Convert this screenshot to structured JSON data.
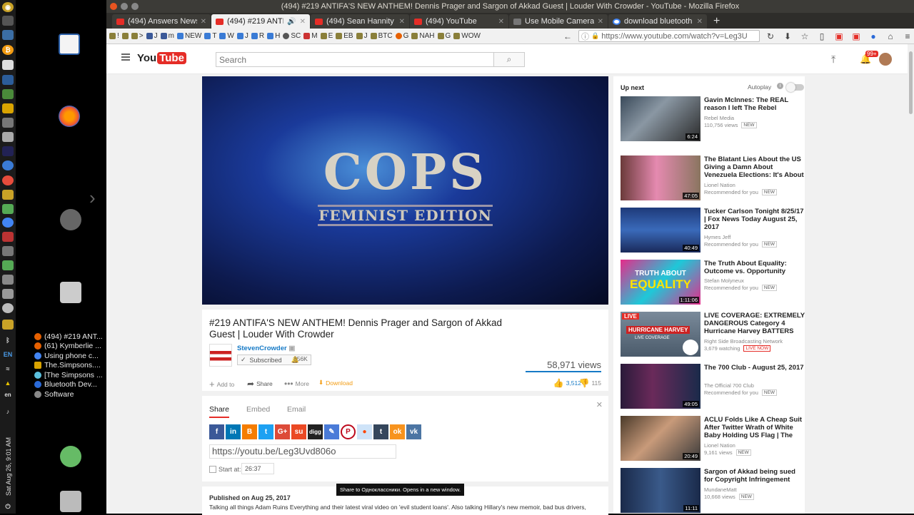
{
  "window": {
    "title": "(494) #219 ANTIFA'S NEW ANTHEM! Dennis Prager and Sargon of Akkad Guest | Louder With Crowder - YouTube - Mozilla Firefox"
  },
  "desktop_sidebar": {
    "clock": "Sat Aug 26, 9:01 AM",
    "lang": "en",
    "lang_en": "EN",
    "taskbar": [
      "(494) #219 ANT...",
      "(61) Kymberlie ...",
      "Using phone c...",
      "The.Simpsons....",
      "[The Simpsons ...",
      "Bluetooth Dev...",
      "Software"
    ]
  },
  "tabs": [
    {
      "label": "(494) Answers News –",
      "active": false
    },
    {
      "label": "(494) #219 ANTIFA'S",
      "active": true
    },
    {
      "label": "(494) Sean Hannity 8/2",
      "active": false
    },
    {
      "label": "(494) YouTube",
      "active": false
    },
    {
      "label": "Use Mobile Camera As",
      "active": false
    },
    {
      "label": "download bluetooth d",
      "active": false
    }
  ],
  "bookmarks": [
    "!",
    ">",
    "J",
    "m",
    "NEW",
    "T",
    "W",
    "J",
    "R",
    "H",
    "SC",
    "M",
    "E",
    "EB",
    "J",
    "BTC",
    "G",
    "NAH",
    "G",
    "WOW"
  ],
  "url": "https://www.youtube.com/watch?v=Leg3U",
  "youtube": {
    "logo_you": "You",
    "logo_tube": "Tube",
    "search_placeholder": "Search",
    "notif_count": "99+"
  },
  "player": {
    "title": "COPS",
    "subtitle": "FEMINIST EDITION"
  },
  "video": {
    "title": "#219 ANTIFA'S NEW ANTHEM! Dennis Prager and Sargon of Akkad Guest | Louder With Crowder",
    "channel": "StevenCrowder",
    "subscribed": "Subscribed",
    "subscribers": "856K",
    "views": "58,971 views",
    "likes": "3,512",
    "dislikes": "115",
    "actions": {
      "add": "Add to",
      "share": "Share",
      "more": "More",
      "download": "Download"
    }
  },
  "share": {
    "tabs": [
      "Share",
      "Embed",
      "Email"
    ],
    "tooltip": "Share to Одноклассники. Opens in a new window.",
    "url": "https://youtu.be/Leg3Uvd806o",
    "start_label": "Start at:",
    "start_time": "26:37"
  },
  "description": {
    "published": "Published on Aug 25, 2017",
    "text": "Talking all things Adam Ruins Everything and their latest viral video on 'evil student loans'. Also talking Hillary's new memoir, bad bus drivers,"
  },
  "upnext": {
    "label": "Up next",
    "autoplay": "Autoplay",
    "items": [
      {
        "title": "Gavin McInnes: The REAL reason I left The Rebel",
        "channel": "Rebel Media",
        "meta": "110,756 views",
        "badge": "NEW",
        "duration": "6:24"
      },
      {
        "title": "The Blatant Lies About the US Giving a Damn About Venezuela Elections: It's About",
        "channel": "Lionel Nation",
        "meta": "Recommended for you",
        "badge": "NEW",
        "duration": "47:05"
      },
      {
        "title": "Tucker Carlson Tonight 8/25/17 | Fox News Today August 25, 2017",
        "channel": "Hymes Jeff",
        "meta": "Recommended for you",
        "badge": "NEW",
        "duration": "40:49"
      },
      {
        "title": "The Truth About Equality: Outcome vs. Opportunity",
        "channel": "Stefan Molyneux",
        "meta": "Recommended for you",
        "badge": "NEW",
        "duration": "1:11:06"
      },
      {
        "title": "LIVE COVERAGE: EXTREMELY DANGEROUS Category 4 Hurricane Harvey BATTERS",
        "channel": "Right Side Broadcasting Network",
        "meta": "3,679 watching",
        "badge": "LIVE NOW",
        "duration": ""
      },
      {
        "title": "The 700 Club - August 25, 2017",
        "channel": "The Official 700 Club",
        "meta": "Recommended for you",
        "badge": "NEW",
        "duration": "49:05"
      },
      {
        "title": "ACLU Folds Like A Cheap Suit After Twitter Wrath of White Baby Holding US Flag | The",
        "channel": "Lionel Nation",
        "meta": "9,161 views",
        "badge": "NEW",
        "duration": "20:49"
      },
      {
        "title": "Sargon of Akkad being sued for Copyright Infringement",
        "channel": "MundaneMatt",
        "meta": "10,668 views",
        "badge": "NEW",
        "duration": "11:11"
      }
    ]
  },
  "thumb_texts": {
    "equality_top": "TRUTH ABOUT",
    "equality_main": "EQUALITY",
    "live_tag": "LIVE",
    "harvey": "HURRICANE HARVEY",
    "harvey_sub": "LIVE COVERAGE"
  },
  "colors": {
    "youtube_red": "#e52d27",
    "link_blue": "#167ac6",
    "download_orange": "#f39c12"
  }
}
